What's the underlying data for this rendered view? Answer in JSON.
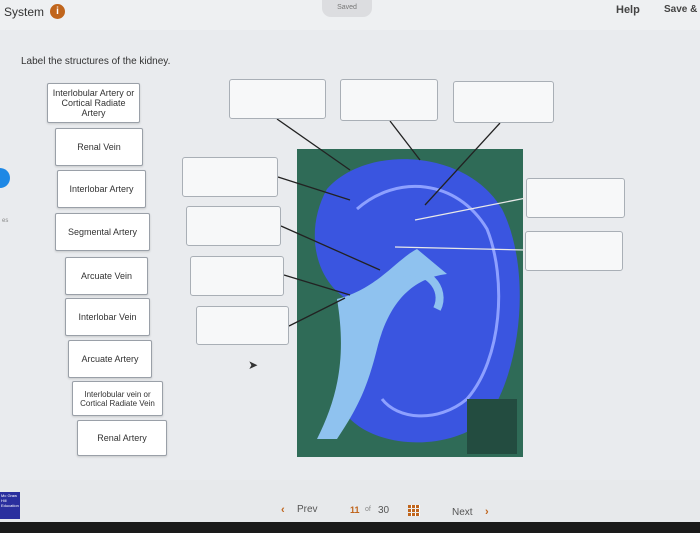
{
  "header": {
    "title": "System",
    "info_icon": "info-icon",
    "saved": "Saved",
    "help": "Help",
    "save_exit": "Save &"
  },
  "question": "Label the structures of the kidney.",
  "side_tab": "es",
  "labels": [
    "Interlobular Artery or Cortical Radiate Artery",
    "Renal Vein",
    "Interlobar Artery",
    "Segmental Artery",
    "Arcuate Vein",
    "Interlobar Vein",
    "Arcuate Artery",
    "Interlobular vein or Cortical Radiate Vein",
    "Renal Artery"
  ],
  "drop_targets_count": 9,
  "footer": {
    "prev": "Prev",
    "current": "11",
    "of": "of",
    "total": "30",
    "next": "Next",
    "logo": "Mc Graw Hill Education"
  },
  "colors": {
    "accent": "#c0651c",
    "kidney": "#3a55e0",
    "background_green": "#2f6b57"
  }
}
